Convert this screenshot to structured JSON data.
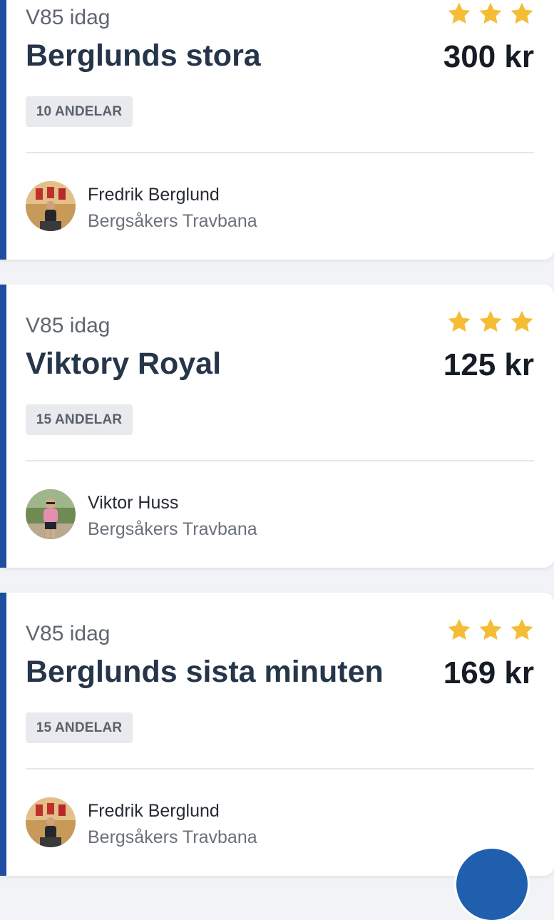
{
  "cards": [
    {
      "game": "V85 idag",
      "title": "Berglunds stora",
      "price": "300 kr",
      "stars": 3,
      "shares": "10 ANDELAR",
      "person": "Fredrik Berglund",
      "venue": "Bergsåkers Travbana",
      "avatar_icon": "person-photo-red-shirts-icon"
    },
    {
      "game": "V85 idag",
      "title": "Viktory Royal",
      "price": "125 kr",
      "stars": 3,
      "shares": "15 ANDELAR",
      "person": "Viktor Huss",
      "venue": "Bergsåkers Travbana",
      "avatar_icon": "person-photo-outdoor-icon"
    },
    {
      "game": "V85 idag",
      "title": "Berglunds sista minuten",
      "price": "169 kr",
      "stars": 3,
      "shares": "15 ANDELAR",
      "person": "Fredrik Berglund",
      "venue": "Bergsåkers Travbana",
      "avatar_icon": "person-photo-red-shirts-icon"
    }
  ],
  "colors": {
    "accent": "#1f4ea0",
    "star": "#f4bd35",
    "title": "#26364a",
    "background": "#f1f3f6"
  }
}
